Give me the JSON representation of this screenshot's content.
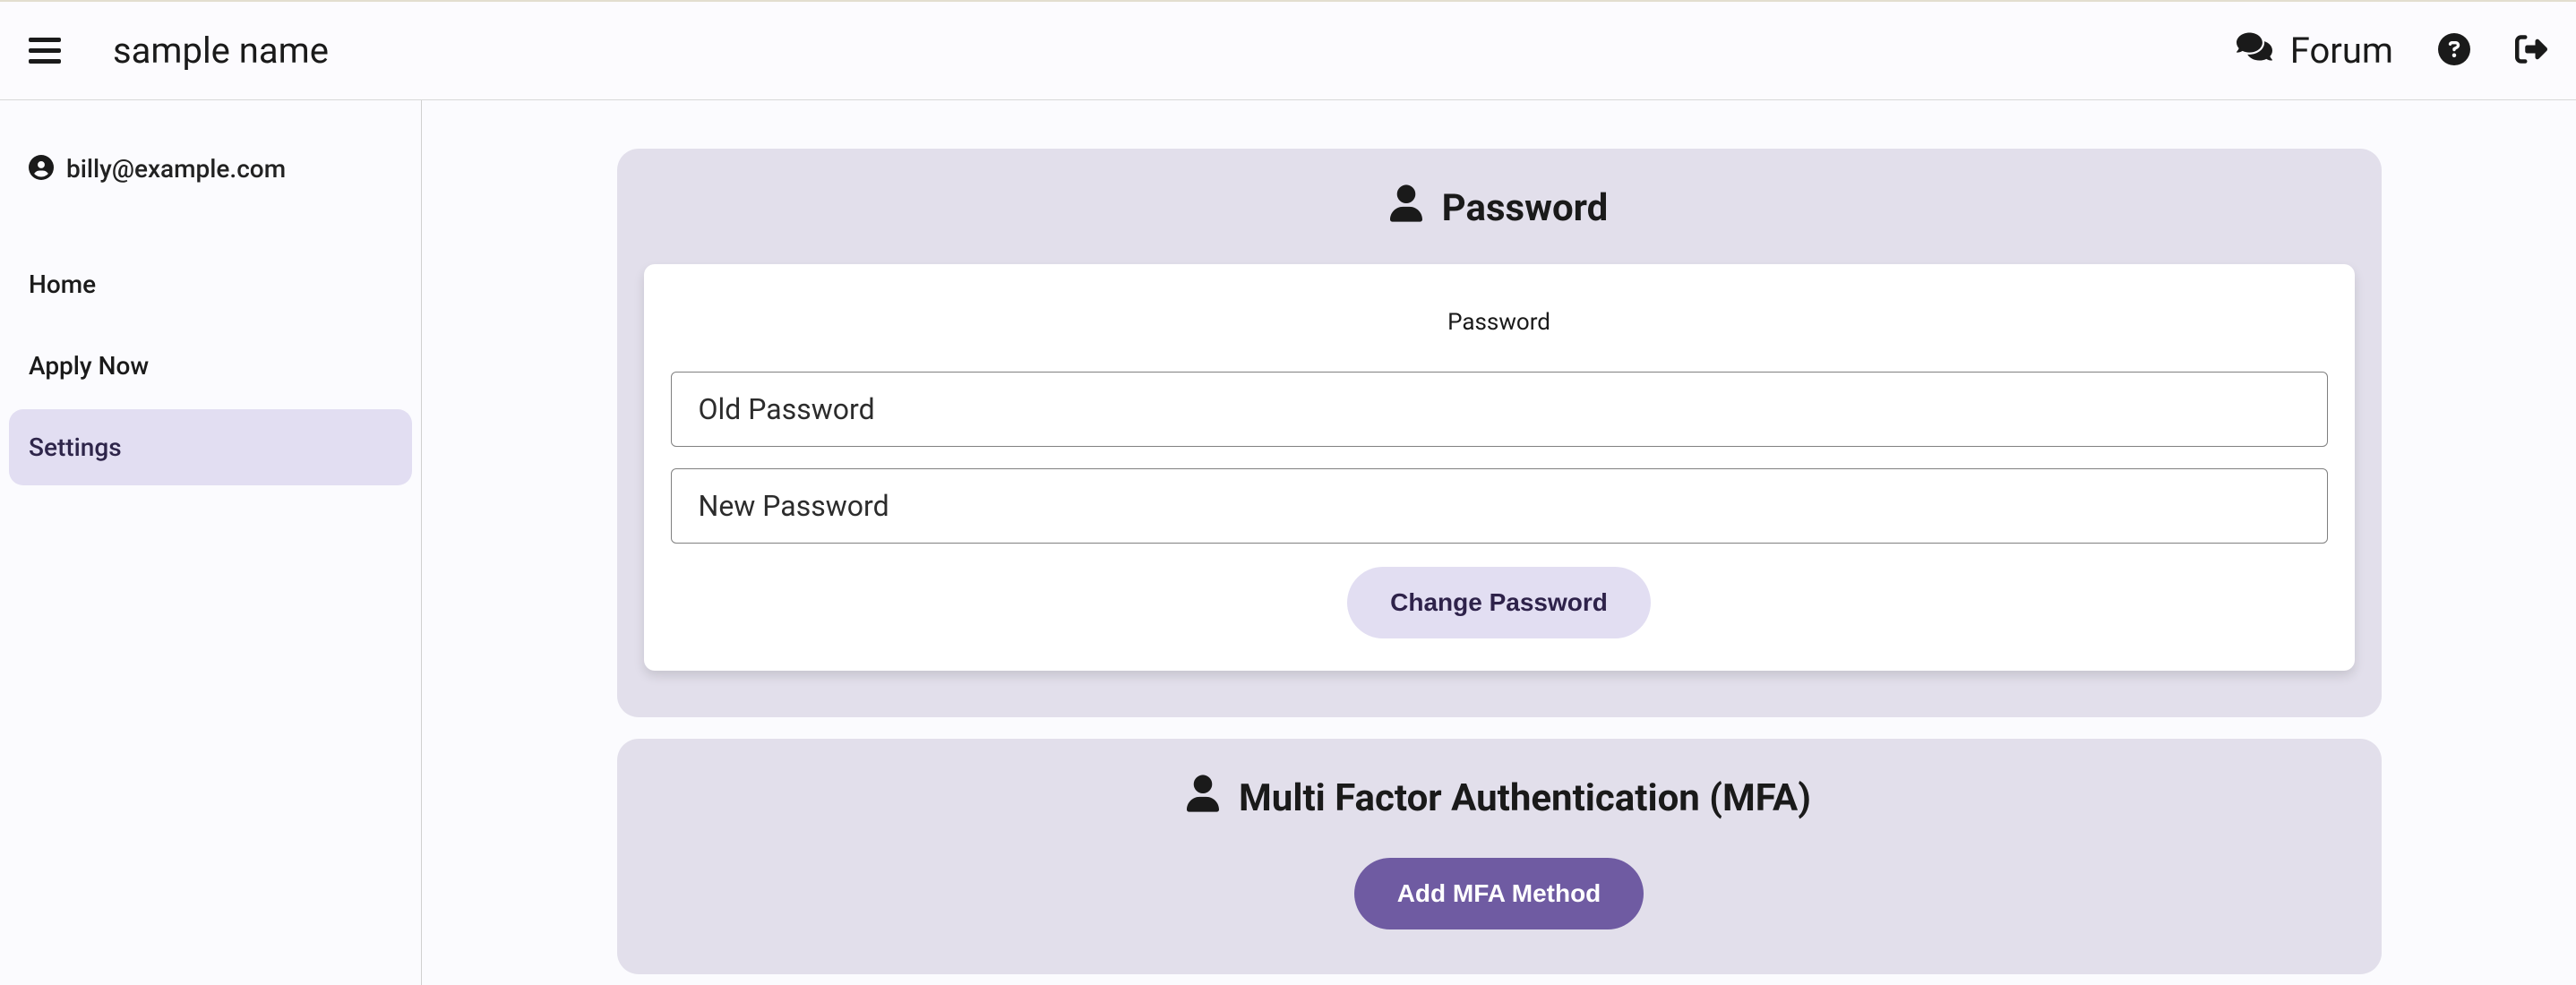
{
  "header": {
    "app_title": "sample name",
    "forum_label": "Forum"
  },
  "sidebar": {
    "user_email": "billy@example.com",
    "items": [
      {
        "label": "Home",
        "active": false
      },
      {
        "label": "Apply Now",
        "active": false
      },
      {
        "label": "Settings",
        "active": true
      }
    ]
  },
  "main": {
    "password_section": {
      "title": "Password",
      "card_heading": "Password",
      "old_password_placeholder": "Old Password",
      "new_password_placeholder": "New Password",
      "change_button": "Change Password"
    },
    "mfa_section": {
      "title": "Multi Factor Authentication (MFA)",
      "add_button": "Add MFA Method"
    }
  }
}
